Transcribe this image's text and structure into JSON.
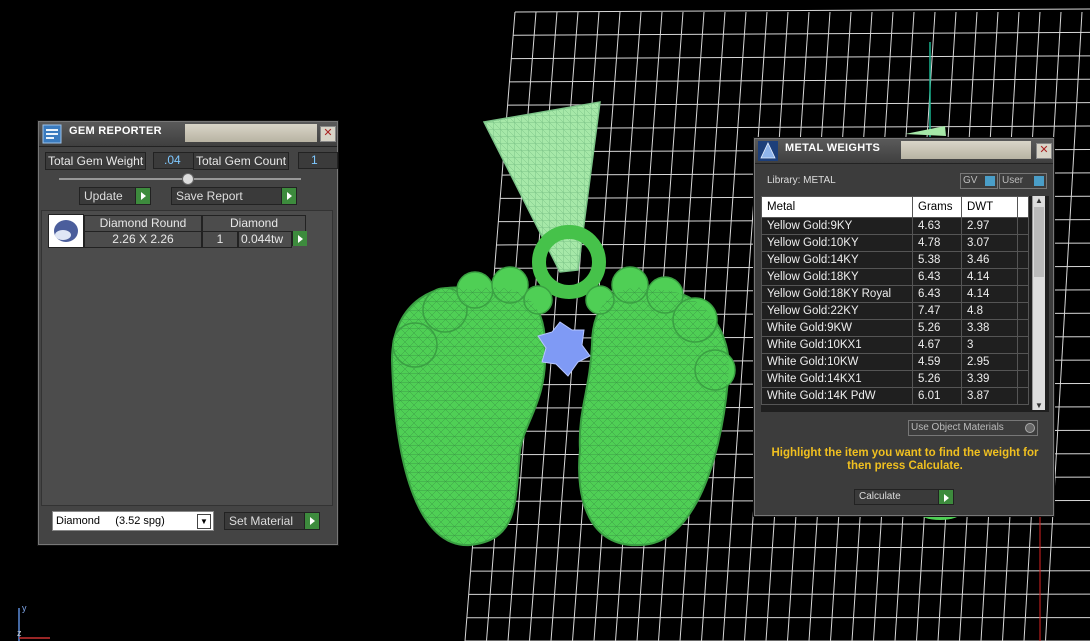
{
  "viewport": {
    "axis_y": "y",
    "axis_z": "z"
  },
  "gem_reporter": {
    "title": "GEM REPORTER",
    "close": "✕",
    "total_weight_label": "Total Gem Weight",
    "total_weight_value": ".04",
    "total_count_label": "Total Gem Count",
    "total_count_value": "1",
    "update_label": "Update",
    "save_report_label": "Save Report",
    "gem": {
      "name": "Diamond Round",
      "material": "Diamond",
      "size": "2.26 X 2.26",
      "count": "1",
      "weight": "0.044tw"
    },
    "material_select": "Diamond     (3.52 spg)",
    "set_material_label": "Set Material"
  },
  "metal_weights": {
    "title": "METAL WEIGHTS",
    "close": "✕",
    "library_label": "Library: METAL",
    "gv_label": "GV",
    "user_label": "User",
    "columns": [
      "Metal",
      "Grams",
      "DWT"
    ],
    "rows": [
      [
        "Yellow Gold:9KY",
        "4.63",
        "2.97"
      ],
      [
        "Yellow Gold:10KY",
        "4.78",
        "3.07"
      ],
      [
        "Yellow Gold:14KY",
        "5.38",
        "3.46"
      ],
      [
        "Yellow Gold:18KY",
        "6.43",
        "4.14"
      ],
      [
        "Yellow Gold:18KY Royal",
        "6.43",
        "4.14"
      ],
      [
        "Yellow Gold:22KY",
        "7.47",
        "4.8"
      ],
      [
        "White Gold:9KW",
        "5.26",
        "3.38"
      ],
      [
        "White Gold:10KX1",
        "4.67",
        "3"
      ],
      [
        "White Gold:10KW",
        "4.59",
        "2.95"
      ],
      [
        "White Gold:14KX1",
        "5.26",
        "3.39"
      ],
      [
        "White Gold:14K PdW",
        "6.01",
        "3.87"
      ]
    ],
    "use_object_materials_label": "Use Object Materials",
    "hint": "Highlight the item you want to find the weight for then press Calculate.",
    "calculate_label": "Calculate"
  }
}
